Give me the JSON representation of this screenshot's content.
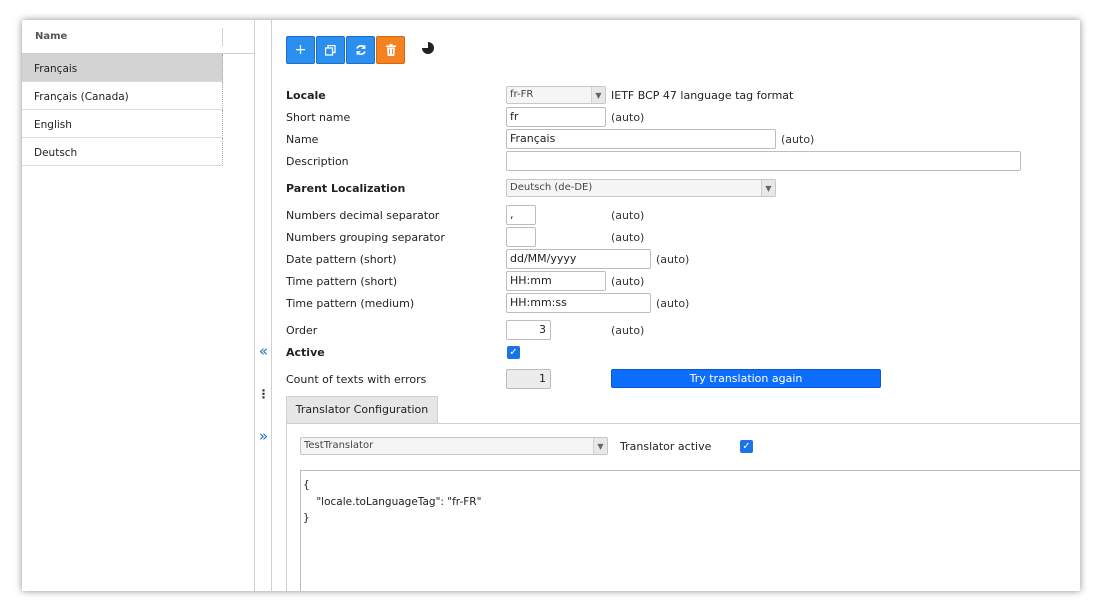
{
  "list": {
    "header": "Name",
    "items": [
      "Français",
      "Français (Canada)",
      "English",
      "Deutsch"
    ],
    "selected_index": 0
  },
  "toolbar": {
    "add_icon": "plus-icon",
    "duplicate_icon": "copy-icon",
    "refresh_icon": "refresh-icon",
    "delete_icon": "trash-icon",
    "stats_icon": "pie-chart-icon"
  },
  "form": {
    "locale_label": "Locale",
    "locale_value": "fr-FR",
    "locale_hint": "IETF BCP 47 language tag format",
    "short_name_label": "Short name",
    "short_name_value": "fr",
    "name_label": "Name",
    "name_value": "Français",
    "description_label": "Description",
    "description_value": "",
    "parent_label": "Parent Localization",
    "parent_value": "Deutsch (de-DE)",
    "decimal_label": "Numbers decimal separator",
    "decimal_value": ",",
    "grouping_label": "Numbers grouping separator",
    "grouping_value": "",
    "date_short_label": "Date pattern (short)",
    "date_short_value": "dd/MM/yyyy",
    "time_short_label": "Time pattern (short)",
    "time_short_value": "HH:mm",
    "time_medium_label": "Time pattern (medium)",
    "time_medium_value": "HH:mm:ss",
    "order_label": "Order",
    "order_value": "3",
    "active_label": "Active",
    "active_checked": true,
    "errors_label": "Count of texts with errors",
    "errors_value": "1",
    "try_button": "Try translation again",
    "auto": "(auto)"
  },
  "translator": {
    "tab_label": "Translator Configuration",
    "select_value": "TestTranslator",
    "active_label": "Translator active",
    "active_checked": true,
    "json_line1": "{",
    "json_line2": "    \"locale.toLanguageTag\": \"fr-FR\"",
    "json_line3": "}"
  },
  "colors": {
    "primary": "#2b8ff0",
    "danger": "#f58220",
    "accent": "#0d6efd",
    "selected_row": "#d3d3d3"
  }
}
